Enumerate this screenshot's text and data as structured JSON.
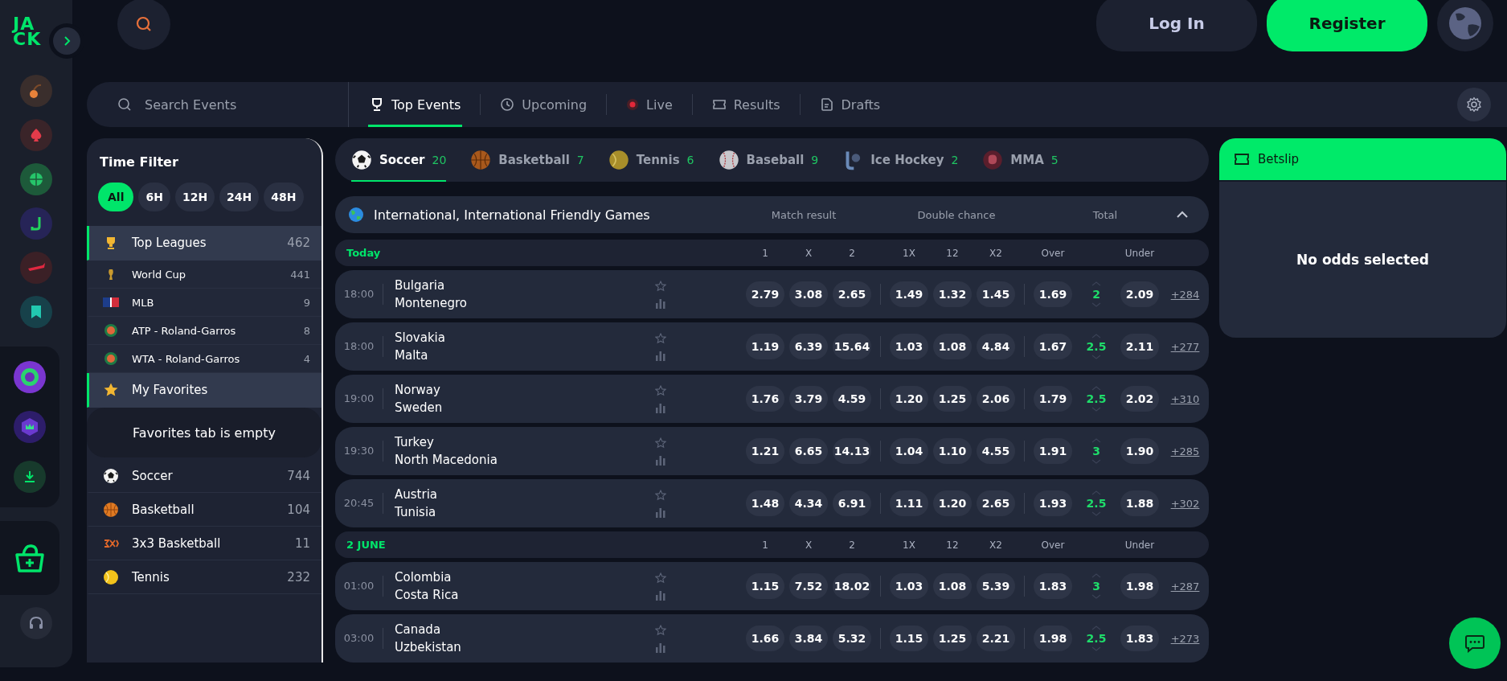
{
  "logo": [
    "JA",
    "CK"
  ],
  "header": {
    "login": "Log In",
    "register": "Register"
  },
  "nav": {
    "search_placeholder": "Search Events",
    "tabs": [
      {
        "label": "Top Events",
        "kind": "trophy",
        "selected": true
      },
      {
        "label": "Upcoming",
        "kind": "clock",
        "selected": false
      },
      {
        "label": "Live",
        "kind": "live",
        "selected": false
      },
      {
        "label": "Results",
        "kind": "ticket",
        "selected": false
      },
      {
        "label": "Drafts",
        "kind": "doc",
        "selected": false
      }
    ]
  },
  "sidebar": {
    "time_filter": {
      "title": "Time Filter",
      "options": [
        {
          "label": "All",
          "selected": true
        },
        {
          "label": "6H",
          "selected": false
        },
        {
          "label": "12H",
          "selected": false
        },
        {
          "label": "24H",
          "selected": false
        },
        {
          "label": "48H",
          "selected": false
        }
      ]
    },
    "top_leagues": {
      "label": "Top Leagues",
      "count": "462",
      "selected": true
    },
    "leagues": [
      {
        "name": "World Cup",
        "count": "441",
        "kind": "cup"
      },
      {
        "name": "MLB",
        "count": "9",
        "kind": "mlb"
      },
      {
        "name": "ATP - Roland-Garros",
        "count": "8",
        "kind": "clay"
      },
      {
        "name": "WTA - Roland-Garros",
        "count": "4",
        "kind": "clay"
      }
    ],
    "favorites": {
      "label": "My Favorites",
      "selected": true,
      "empty_text": "Favorites tab is empty"
    },
    "sports": [
      {
        "name": "Soccer",
        "count": "744",
        "kind": "soccer"
      },
      {
        "name": "Basketball",
        "count": "104",
        "kind": "basketball"
      },
      {
        "name": "3x3 Basketball",
        "count": "11",
        "kind": "threex"
      },
      {
        "name": "Tennis",
        "count": "232",
        "kind": "tennis"
      }
    ]
  },
  "sports_tabs": [
    {
      "label": "Soccer",
      "count": "20",
      "kind": "soccer",
      "selected": true
    },
    {
      "label": "Basketball",
      "count": "7",
      "kind": "basketball",
      "selected": false
    },
    {
      "label": "Tennis",
      "count": "6",
      "kind": "tennis",
      "selected": false
    },
    {
      "label": "Baseball",
      "count": "9",
      "kind": "baseball",
      "selected": false
    },
    {
      "label": "Ice Hockey",
      "count": "2",
      "kind": "hockey",
      "selected": false
    },
    {
      "label": "MMA",
      "count": "5",
      "kind": "mma",
      "selected": false
    }
  ],
  "league": {
    "title": "International, International Friendly Games",
    "markets": [
      "Match result",
      "Double chance",
      "Total"
    ],
    "expanded": true
  },
  "days": [
    {
      "label": "Today",
      "columns": [
        "1",
        "X",
        "2",
        "1X",
        "12",
        "X2",
        "Over",
        "Under"
      ],
      "matches": [
        {
          "time": "18:00",
          "home": "Bulgaria",
          "away": "Montenegro",
          "odds": [
            "2.79",
            "3.08",
            "2.65",
            "1.49",
            "1.32",
            "1.45"
          ],
          "over": "1.69",
          "line": "2",
          "under": "2.09",
          "more": "+284"
        },
        {
          "time": "18:00",
          "home": "Slovakia",
          "away": "Malta",
          "odds": [
            "1.19",
            "6.39",
            "15.64",
            "1.03",
            "1.08",
            "4.84"
          ],
          "over": "1.67",
          "line": "2.5",
          "under": "2.11",
          "more": "+277"
        },
        {
          "time": "19:00",
          "home": "Norway",
          "away": "Sweden",
          "odds": [
            "1.76",
            "3.79",
            "4.59",
            "1.20",
            "1.25",
            "2.06"
          ],
          "over": "1.79",
          "line": "2.5",
          "under": "2.02",
          "more": "+310"
        },
        {
          "time": "19:30",
          "home": "Turkey",
          "away": "North Macedonia",
          "odds": [
            "1.21",
            "6.65",
            "14.13",
            "1.04",
            "1.10",
            "4.55"
          ],
          "over": "1.91",
          "line": "3",
          "under": "1.90",
          "more": "+285"
        },
        {
          "time": "20:45",
          "home": "Austria",
          "away": "Tunisia",
          "odds": [
            "1.48",
            "4.34",
            "6.91",
            "1.11",
            "1.20",
            "2.65"
          ],
          "over": "1.93",
          "line": "2.5",
          "under": "1.88",
          "more": "+302"
        }
      ]
    },
    {
      "label": "2 JUNE",
      "columns": [
        "1",
        "X",
        "2",
        "1X",
        "12",
        "X2",
        "Over",
        "Under"
      ],
      "matches": [
        {
          "time": "01:00",
          "home": "Colombia",
          "away": "Costa Rica",
          "odds": [
            "1.15",
            "7.52",
            "18.02",
            "1.03",
            "1.08",
            "5.39"
          ],
          "over": "1.83",
          "line": "3",
          "under": "1.98",
          "more": "+287"
        },
        {
          "time": "03:00",
          "home": "Canada",
          "away": "Uzbekistan",
          "odds": [
            "1.66",
            "3.84",
            "5.32",
            "1.15",
            "1.25",
            "2.21"
          ],
          "over": "1.98",
          "line": "2.5",
          "under": "1.83",
          "more": "+273"
        }
      ]
    }
  ],
  "betslip": {
    "title": "Betslip",
    "empty_text": "No odds selected"
  }
}
